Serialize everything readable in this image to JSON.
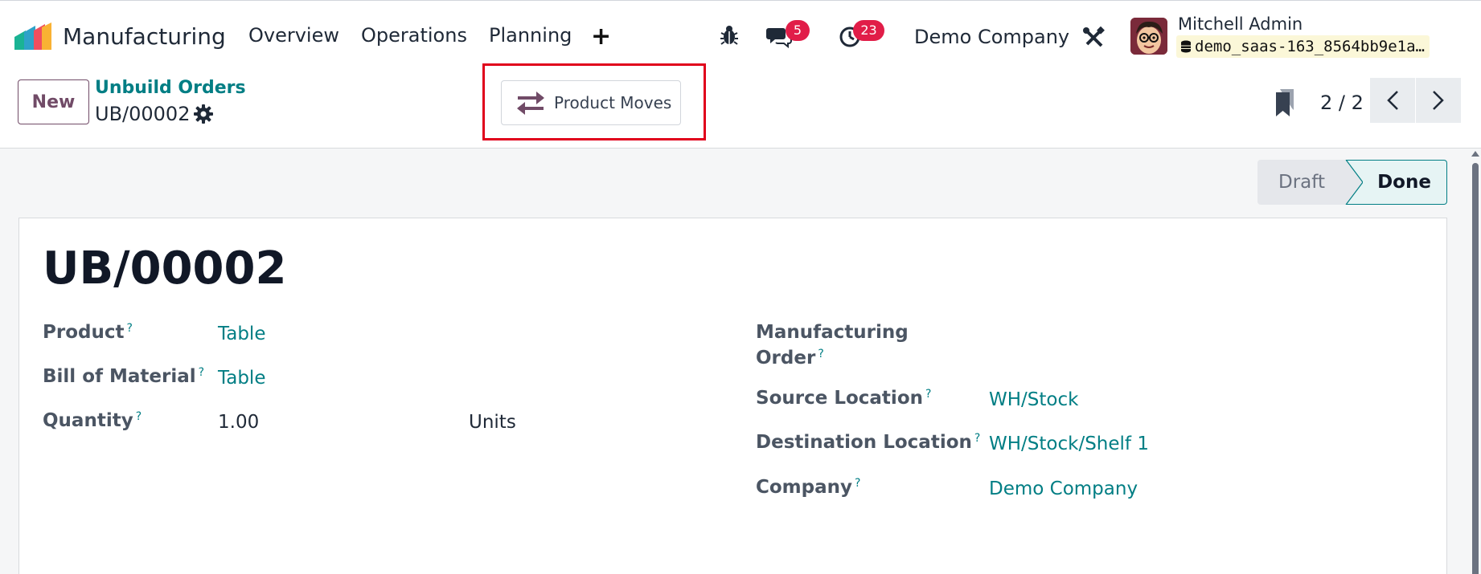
{
  "navbar": {
    "app_name": "Manufacturing",
    "menu": [
      "Overview",
      "Operations",
      "Planning"
    ],
    "plus": "+",
    "messages_badge": "5",
    "activities_badge": "23",
    "company": "Demo Company",
    "user_name": "Mitchell Admin",
    "database": "demo_saas-163_8564bb9e1a…"
  },
  "control": {
    "new_label": "New",
    "breadcrumb_parent": "Unbuild Orders",
    "breadcrumb_current": "UB/00002",
    "smart_button_label": "Product Moves",
    "pager": "2 / 2"
  },
  "status": {
    "stages": [
      "Draft",
      "Done"
    ],
    "active": "Done"
  },
  "form": {
    "title": "UB/00002",
    "left": {
      "product_label": "Product",
      "product_value": "Table",
      "bom_label": "Bill of Material",
      "bom_value": "Table",
      "quantity_label": "Quantity",
      "quantity_value": "1.00",
      "uom_value": "Units"
    },
    "right": {
      "mo_label_line1": "Manufacturing",
      "mo_label_line2": "Order",
      "source_label": "Source Location",
      "source_value": "WH/Stock",
      "dest_label": "Destination Location",
      "dest_value": "WH/Stock/Shelf 1",
      "company_label": "Company",
      "company_value": "Demo Company"
    },
    "help_mark": "?"
  },
  "colors": {
    "brand": "#714b67",
    "link": "#017e84",
    "badge": "#e11d48",
    "highlight": "#e0001b"
  }
}
